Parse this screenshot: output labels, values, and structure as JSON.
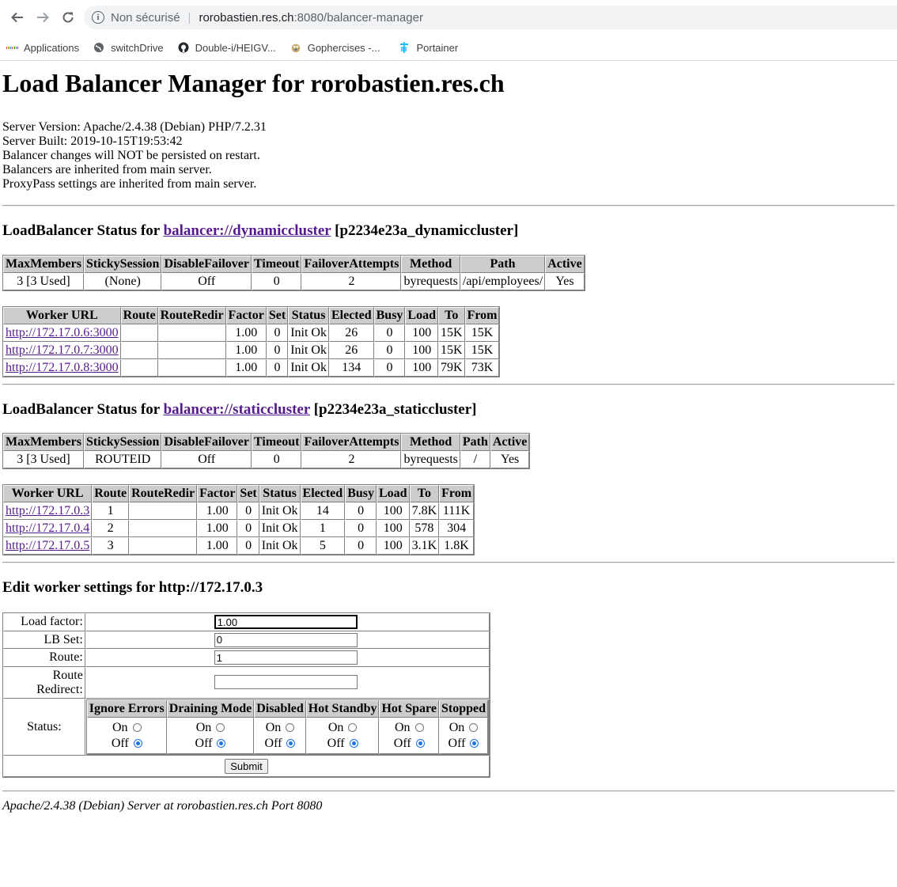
{
  "browser": {
    "security_label": "Non sécurisé",
    "url_host": "rorobastien.res.ch",
    "url_path": ":8080/balancer-manager",
    "bookmarks": [
      {
        "label": "Applications"
      },
      {
        "label": "switchDrive"
      },
      {
        "label": "Double-i/HEIGV..."
      },
      {
        "label": "Gophercises -..."
      },
      {
        "label": "Portainer"
      }
    ]
  },
  "page": {
    "title": "Load Balancer Manager for rorobastien.res.ch",
    "server_version": "Server Version: Apache/2.4.38 (Debian) PHP/7.2.31",
    "server_built": "Server Built: 2019-10-15T19:53:42",
    "note1": "Balancer changes will NOT be persisted on restart.",
    "note2": "Balancers are inherited from main server.",
    "note3": "ProxyPass settings are inherited from main server."
  },
  "balancers": [
    {
      "heading_prefix": "LoadBalancer Status for ",
      "link": "balancer://dynamiccluster",
      "suffix": " [p2234e23a_dynamiccluster]",
      "status_headers": [
        "MaxMembers",
        "StickySession",
        "DisableFailover",
        "Timeout",
        "FailoverAttempts",
        "Method",
        "Path",
        "Active"
      ],
      "status_row": [
        "3 [3 Used]",
        "(None)",
        "Off",
        "0",
        "2",
        "byrequests",
        "/api/employees/",
        "Yes"
      ],
      "worker_headers": [
        "Worker URL",
        "Route",
        "RouteRedir",
        "Factor",
        "Set",
        "Status",
        "Elected",
        "Busy",
        "Load",
        "To",
        "From"
      ],
      "workers": [
        [
          "http://172.17.0.6:3000",
          "",
          "",
          "1.00",
          "0",
          "Init Ok",
          "26",
          "0",
          "100",
          "15K",
          "15K"
        ],
        [
          "http://172.17.0.7:3000",
          "",
          "",
          "1.00",
          "0",
          "Init Ok",
          "26",
          "0",
          "100",
          "15K",
          "15K"
        ],
        [
          "http://172.17.0.8:3000",
          "",
          "",
          "1.00",
          "0",
          "Init Ok",
          "134",
          "0",
          "100",
          "79K",
          "73K"
        ]
      ]
    },
    {
      "heading_prefix": "LoadBalancer Status for ",
      "link": "balancer://staticcluster",
      "suffix": " [p2234e23a_staticcluster]",
      "status_headers": [
        "MaxMembers",
        "StickySession",
        "DisableFailover",
        "Timeout",
        "FailoverAttempts",
        "Method",
        "Path",
        "Active"
      ],
      "status_row": [
        "3 [3 Used]",
        "ROUTEID",
        "Off",
        "0",
        "2",
        "byrequests",
        "/",
        "Yes"
      ],
      "worker_headers": [
        "Worker URL",
        "Route",
        "RouteRedir",
        "Factor",
        "Set",
        "Status",
        "Elected",
        "Busy",
        "Load",
        "To",
        "From"
      ],
      "workers": [
        [
          "http://172.17.0.3",
          "1",
          "",
          "1.00",
          "0",
          "Init Ok",
          "14",
          "0",
          "100",
          "7.8K",
          "111K"
        ],
        [
          "http://172.17.0.4",
          "2",
          "",
          "1.00",
          "0",
          "Init Ok",
          "1",
          "0",
          "100",
          "578",
          "304"
        ],
        [
          "http://172.17.0.5",
          "3",
          "",
          "1.00",
          "0",
          "Init Ok",
          "5",
          "0",
          "100",
          "3.1K",
          "1.8K"
        ]
      ]
    }
  ],
  "edit": {
    "heading": "Edit worker settings for http://172.17.0.3",
    "load_factor_label": "Load factor:",
    "load_factor_value": "1.00",
    "lbset_label": "LB Set:",
    "lbset_value": "0",
    "route_label": "Route:",
    "route_value": "1",
    "route_redirect_label": "Route Redirect:",
    "route_redirect_value": "",
    "status_label": "Status:",
    "status_headers": [
      "Ignore Errors",
      "Draining Mode",
      "Disabled",
      "Hot Standby",
      "Hot Spare",
      "Stopped"
    ],
    "on_label": "On",
    "off_label": "Off",
    "selected": [
      "off",
      "off",
      "off",
      "off",
      "off",
      "off"
    ],
    "submit_label": "Submit"
  },
  "footer": "Apache/2.4.38 (Debian) Server at rorobastien.res.ch Port 8080"
}
